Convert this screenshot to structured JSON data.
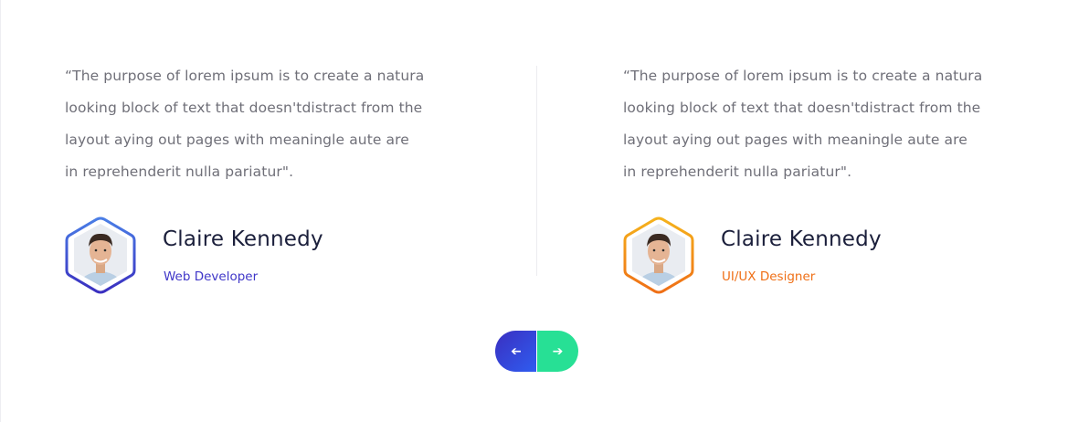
{
  "testimonials": [
    {
      "quote": "“The purpose of lorem ipsum is to create a natura\nlooking block of text that doesn'tdistract from the\nlayout aying out pages with meaningle aute are\nin reprehenderit nulla pariatur\".",
      "name": "Claire Kennedy",
      "role": "Web Developer",
      "accent": "#3f36c8",
      "ring_gradient": [
        "#4a7ee6",
        "#3a2fc0"
      ]
    },
    {
      "quote": "“The purpose of lorem ipsum is to create a natura\nlooking block of text that doesn'tdistract from the\nlayout aying out pages with meaningle aute are\nin reprehenderit nulla pariatur\".",
      "name": "Claire Kennedy",
      "role": "UI/UX Designer",
      "accent": "#ef6f16",
      "ring_gradient": [
        "#f5b21c",
        "#ef6f16"
      ]
    }
  ],
  "navigation": {
    "prev_icon": "arrow-left-icon",
    "next_icon": "arrow-right-icon",
    "prev_glyph": "➔",
    "next_glyph": "➔",
    "prev_color": "#3a2fc0",
    "next_color": "#27e095"
  }
}
